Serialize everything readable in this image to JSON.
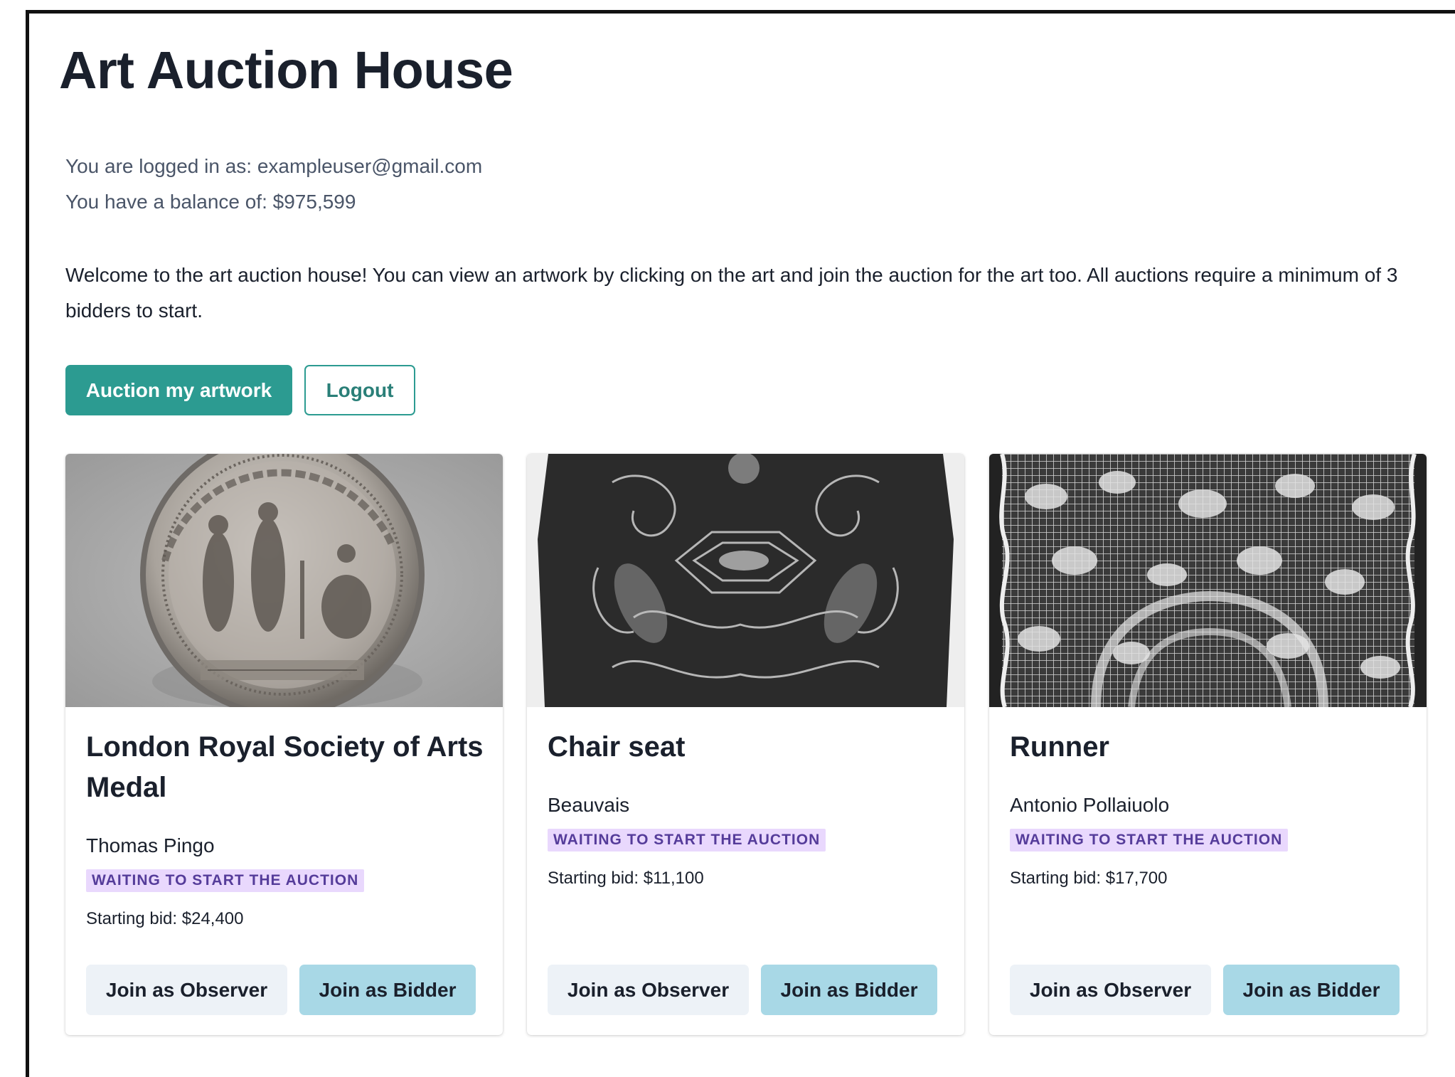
{
  "header": {
    "title": "Art Auction House",
    "logged_in_text": "You are logged in as: exampleuser@gmail.com",
    "balance_text": "You have a balance of: $975,599",
    "welcome_text": "Welcome to the art auction house! You can view an artwork by clicking on the art and join the auction for the art too. All auctions require a minimum of 3 bidders to start."
  },
  "actions": {
    "auction_label": "Auction my artwork",
    "logout_label": "Logout"
  },
  "icons": {
    "close": "close-icon"
  },
  "colors": {
    "primary": "#2c9b91",
    "badge_bg": "#e9d8fd",
    "badge_text": "#553c9a",
    "observer_bg": "#edf2f7",
    "bidder_bg": "#a8d8e6"
  },
  "cards": [
    {
      "title": "London Royal Society of Arts Medal",
      "artist": "Thomas Pingo",
      "status": "WAITING TO START THE AUCTION",
      "starting_bid": "Starting bid: $24,400",
      "observer_label": "Join as Observer",
      "bidder_label": "Join as Bidder",
      "image": "medal-image"
    },
    {
      "title": "Chair seat",
      "artist": "Beauvais",
      "status": "WAITING TO START THE AUCTION",
      "starting_bid": "Starting bid: $11,100",
      "observer_label": "Join as Observer",
      "bidder_label": "Join as Bidder",
      "image": "chair-seat-image"
    },
    {
      "title": "Runner",
      "artist": "Antonio Pollaiuolo",
      "status": "WAITING TO START THE AUCTION",
      "starting_bid": "Starting bid: $17,700",
      "observer_label": "Join as Observer",
      "bidder_label": "Join as Bidder",
      "image": "lace-runner-image"
    }
  ]
}
